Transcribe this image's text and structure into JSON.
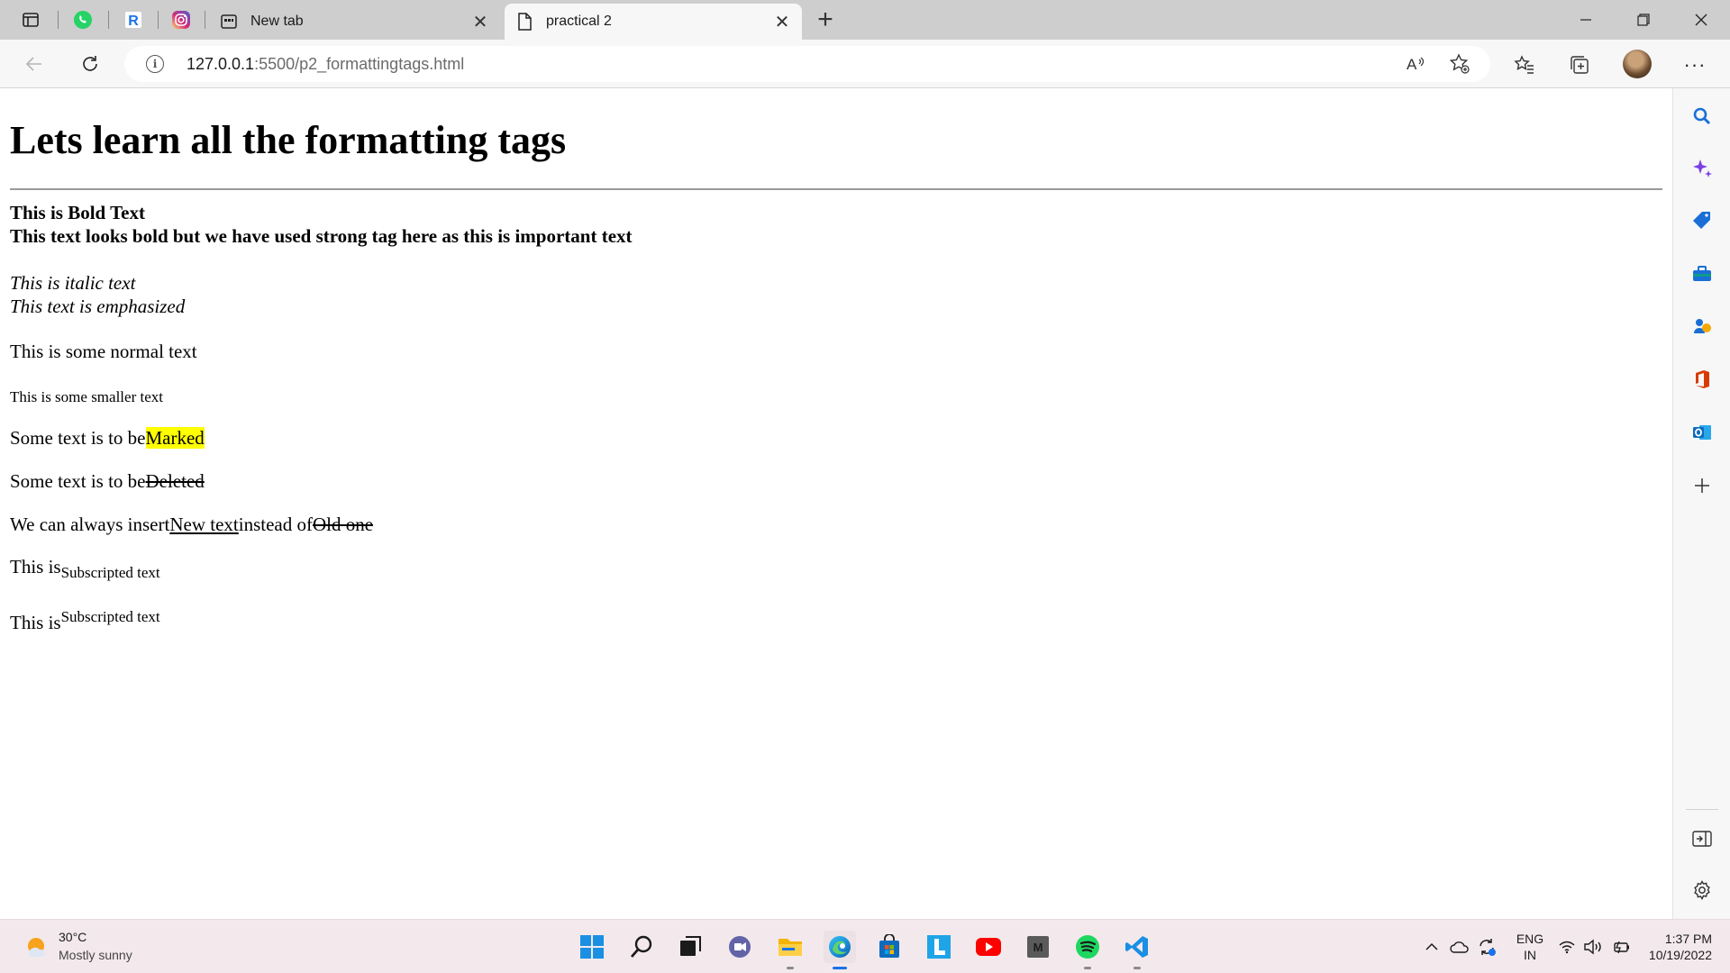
{
  "browser": {
    "tabs": [
      {
        "title": "New tab",
        "active": false
      },
      {
        "title": "practical 2",
        "active": true
      }
    ],
    "pinned_tabs": [
      "whatsapp-icon",
      "r-icon",
      "instagram-icon"
    ],
    "address": {
      "host": "127.0.0.1",
      "rest": ":5500/p2_formattingtags.html"
    },
    "colors": {
      "tabbar": "#cecece",
      "toolbar": "#f7f7f7",
      "taskbar": "#f3e9ec",
      "accent": "#1a73e8"
    }
  },
  "page": {
    "heading": "Lets learn all the formatting tags",
    "bold_text": "This is Bold Text",
    "strong_text": "This text looks bold but we have used strong tag here as this is important text",
    "italic_text": "This is italic text",
    "em_text": "This text is emphasized",
    "normal_text": "This is some normal text",
    "small_text": "This is some smaller text",
    "mark_prefix": "Some text is to be",
    "mark_text": "Marked",
    "del_prefix": "Some text is to be",
    "del_text": "Deleted",
    "ins_prefix": "We can always insert",
    "ins_text": "New text",
    "ins_middle": "instead of",
    "ins_del_text": "Old one",
    "sub_prefix": "This is",
    "sub_text": "Subscripted text",
    "sup_prefix": "This is",
    "sup_text": "Subscripted text",
    "highlight_color": "#ffff00"
  },
  "taskbar": {
    "weather_temp": "30°C",
    "weather_desc": "Mostly sunny",
    "lang_line1": "ENG",
    "lang_line2": "IN",
    "time": "1:37 PM",
    "date": "10/19/2022"
  }
}
